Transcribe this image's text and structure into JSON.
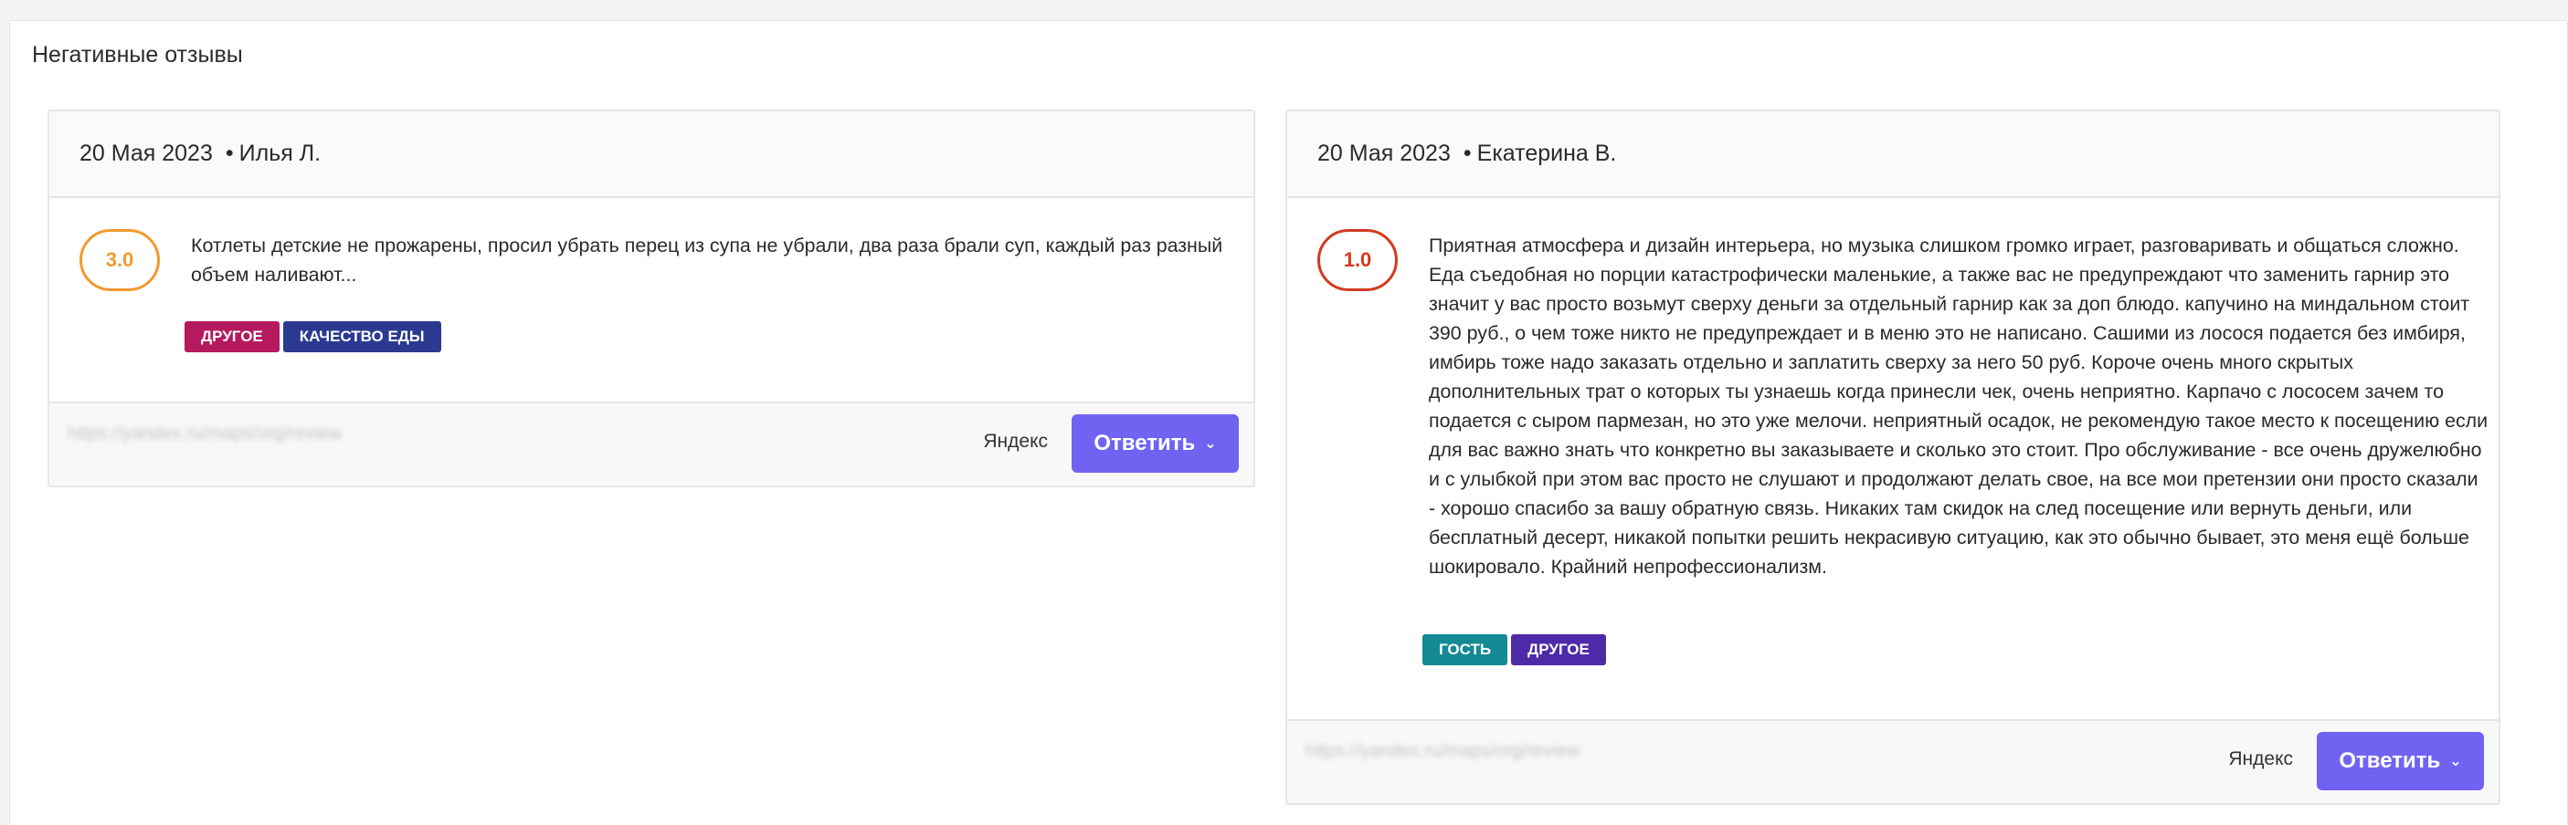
{
  "section": {
    "title": "Негативные отзывы"
  },
  "reviews": [
    {
      "date": "20 Мая 2023",
      "separator": "•",
      "author": "Илья Л.",
      "rating": "3.0",
      "text": "Котлеты детские не прожарены, просил убрать перец из супа не убрали, два раза брали суп, каждый раз разный объем наливают...",
      "tags": [
        {
          "label": "ДРУГОЕ",
          "color": "#b5195e"
        },
        {
          "label": "КАЧЕСТВО ЕДЫ",
          "color": "#2b3990"
        }
      ],
      "link": "https://yandex.ru/maps/org/review",
      "source": "Яндекс",
      "reply_label": "Ответить",
      "chevron": "⌄"
    },
    {
      "date": "20 Мая 2023",
      "separator": "•",
      "author": "Екатерина В.",
      "rating": "1.0",
      "text": "Приятная атмосфера и дизайн интерьера, но музыка слишком громко играет, разговаривать и общаться сложно. Еда съедобная но порции катастрофически маленькие, а также вас не предупреждают что заменить гарнир это значит у вас просто возьмут сверху деньги за отдельный гарнир как за доп блюдо. капучино на миндальном стоит 390 руб., о чем тоже никто не предупреждает и в меню это не написано. Сашими из лосося подается без имбиря, имбирь тоже надо заказать отдельно и заплатить сверху за него 50 руб. Короче очень много скрытых дополнительных трат о которых ты узнаешь когда принесли чек, очень неприятно. Карпачо с лососем зачем то подается с сыром пармезан, но это уже мелочи. неприятный осадок, не рекомендую такое место к посещению если для вас важно знать что конкретно вы заказываете и сколько это стоит. Про обслуживание - все очень дружелюбно и с улыбкой при этом вас просто не слушают и продолжают делать свое, на все мои претензии они просто сказали - хорошо спасибо за вашу обратную связь. Никаких там скидок на след посещение или вернуть деньги, или бесплатный десерт, никакой попытки решить некрасивую ситуацию, как это обычно бывает, это меня ещё больше шокировало. Крайний непрофессионализм.",
      "tags": [
        {
          "label": "ГОСТЬ",
          "color": "#138a94"
        },
        {
          "label": "ДРУГОЕ",
          "color": "#4f2aa8"
        }
      ],
      "link": "https://yandex.ru/maps/org/review",
      "source": "Яндекс",
      "reply_label": "Ответить",
      "chevron": "⌄"
    }
  ],
  "colors": {
    "accent": "#7163f2",
    "rating_mid": "#f29a2e",
    "rating_low": "#d23a1e"
  }
}
